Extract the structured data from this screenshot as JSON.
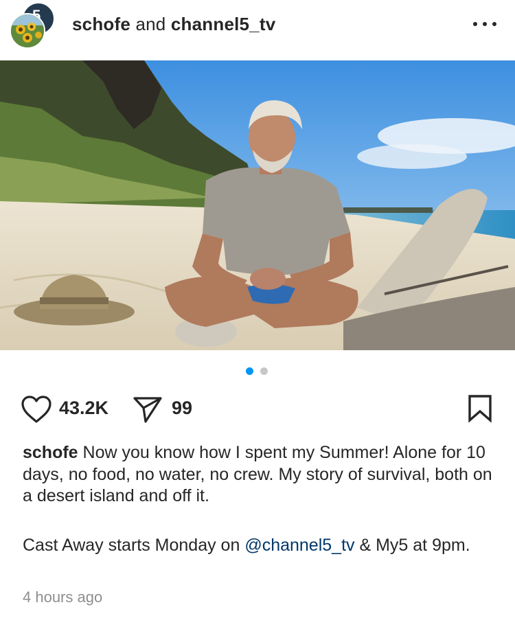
{
  "post": {
    "avatar_badge": "5",
    "account_1": "schofe",
    "connector": "and",
    "account_2": "channel5_tv"
  },
  "carousel": {
    "current": 1,
    "total": 2
  },
  "actions": {
    "likes": "43.2K",
    "shares": "99"
  },
  "caption": {
    "username": "schofe",
    "line1": "Now you know how I spent my Summer! Alone for 10 days, no food, no water, no crew. My story of survival, both on a desert island and off it.",
    "line2_before": "Cast Away starts Monday on ",
    "mention": "@channel5_tv",
    "line2_after": " & My5 at 9pm."
  },
  "timestamp": "4 hours ago",
  "colors": {
    "dot_active": "#0095f6",
    "dot_inactive": "#c7c7c7",
    "mention": "#00376b",
    "muted": "#8e8e8e"
  }
}
